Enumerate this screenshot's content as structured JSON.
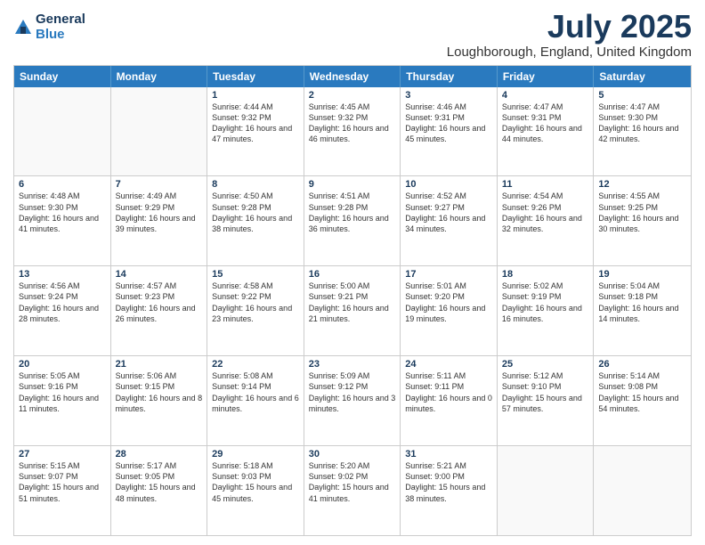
{
  "header": {
    "logo_general": "General",
    "logo_blue": "Blue",
    "title": "July 2025",
    "subtitle": "Loughborough, England, United Kingdom"
  },
  "calendar": {
    "days": [
      "Sunday",
      "Monday",
      "Tuesday",
      "Wednesday",
      "Thursday",
      "Friday",
      "Saturday"
    ],
    "weeks": [
      [
        {
          "day": "",
          "content": ""
        },
        {
          "day": "",
          "content": ""
        },
        {
          "day": "1",
          "content": "Sunrise: 4:44 AM\nSunset: 9:32 PM\nDaylight: 16 hours and 47 minutes."
        },
        {
          "day": "2",
          "content": "Sunrise: 4:45 AM\nSunset: 9:32 PM\nDaylight: 16 hours and 46 minutes."
        },
        {
          "day": "3",
          "content": "Sunrise: 4:46 AM\nSunset: 9:31 PM\nDaylight: 16 hours and 45 minutes."
        },
        {
          "day": "4",
          "content": "Sunrise: 4:47 AM\nSunset: 9:31 PM\nDaylight: 16 hours and 44 minutes."
        },
        {
          "day": "5",
          "content": "Sunrise: 4:47 AM\nSunset: 9:30 PM\nDaylight: 16 hours and 42 minutes."
        }
      ],
      [
        {
          "day": "6",
          "content": "Sunrise: 4:48 AM\nSunset: 9:30 PM\nDaylight: 16 hours and 41 minutes."
        },
        {
          "day": "7",
          "content": "Sunrise: 4:49 AM\nSunset: 9:29 PM\nDaylight: 16 hours and 39 minutes."
        },
        {
          "day": "8",
          "content": "Sunrise: 4:50 AM\nSunset: 9:28 PM\nDaylight: 16 hours and 38 minutes."
        },
        {
          "day": "9",
          "content": "Sunrise: 4:51 AM\nSunset: 9:28 PM\nDaylight: 16 hours and 36 minutes."
        },
        {
          "day": "10",
          "content": "Sunrise: 4:52 AM\nSunset: 9:27 PM\nDaylight: 16 hours and 34 minutes."
        },
        {
          "day": "11",
          "content": "Sunrise: 4:54 AM\nSunset: 9:26 PM\nDaylight: 16 hours and 32 minutes."
        },
        {
          "day": "12",
          "content": "Sunrise: 4:55 AM\nSunset: 9:25 PM\nDaylight: 16 hours and 30 minutes."
        }
      ],
      [
        {
          "day": "13",
          "content": "Sunrise: 4:56 AM\nSunset: 9:24 PM\nDaylight: 16 hours and 28 minutes."
        },
        {
          "day": "14",
          "content": "Sunrise: 4:57 AM\nSunset: 9:23 PM\nDaylight: 16 hours and 26 minutes."
        },
        {
          "day": "15",
          "content": "Sunrise: 4:58 AM\nSunset: 9:22 PM\nDaylight: 16 hours and 23 minutes."
        },
        {
          "day": "16",
          "content": "Sunrise: 5:00 AM\nSunset: 9:21 PM\nDaylight: 16 hours and 21 minutes."
        },
        {
          "day": "17",
          "content": "Sunrise: 5:01 AM\nSunset: 9:20 PM\nDaylight: 16 hours and 19 minutes."
        },
        {
          "day": "18",
          "content": "Sunrise: 5:02 AM\nSunset: 9:19 PM\nDaylight: 16 hours and 16 minutes."
        },
        {
          "day": "19",
          "content": "Sunrise: 5:04 AM\nSunset: 9:18 PM\nDaylight: 16 hours and 14 minutes."
        }
      ],
      [
        {
          "day": "20",
          "content": "Sunrise: 5:05 AM\nSunset: 9:16 PM\nDaylight: 16 hours and 11 minutes."
        },
        {
          "day": "21",
          "content": "Sunrise: 5:06 AM\nSunset: 9:15 PM\nDaylight: 16 hours and 8 minutes."
        },
        {
          "day": "22",
          "content": "Sunrise: 5:08 AM\nSunset: 9:14 PM\nDaylight: 16 hours and 6 minutes."
        },
        {
          "day": "23",
          "content": "Sunrise: 5:09 AM\nSunset: 9:12 PM\nDaylight: 16 hours and 3 minutes."
        },
        {
          "day": "24",
          "content": "Sunrise: 5:11 AM\nSunset: 9:11 PM\nDaylight: 16 hours and 0 minutes."
        },
        {
          "day": "25",
          "content": "Sunrise: 5:12 AM\nSunset: 9:10 PM\nDaylight: 15 hours and 57 minutes."
        },
        {
          "day": "26",
          "content": "Sunrise: 5:14 AM\nSunset: 9:08 PM\nDaylight: 15 hours and 54 minutes."
        }
      ],
      [
        {
          "day": "27",
          "content": "Sunrise: 5:15 AM\nSunset: 9:07 PM\nDaylight: 15 hours and 51 minutes."
        },
        {
          "day": "28",
          "content": "Sunrise: 5:17 AM\nSunset: 9:05 PM\nDaylight: 15 hours and 48 minutes."
        },
        {
          "day": "29",
          "content": "Sunrise: 5:18 AM\nSunset: 9:03 PM\nDaylight: 15 hours and 45 minutes."
        },
        {
          "day": "30",
          "content": "Sunrise: 5:20 AM\nSunset: 9:02 PM\nDaylight: 15 hours and 41 minutes."
        },
        {
          "day": "31",
          "content": "Sunrise: 5:21 AM\nSunset: 9:00 PM\nDaylight: 15 hours and 38 minutes."
        },
        {
          "day": "",
          "content": ""
        },
        {
          "day": "",
          "content": ""
        }
      ]
    ]
  }
}
